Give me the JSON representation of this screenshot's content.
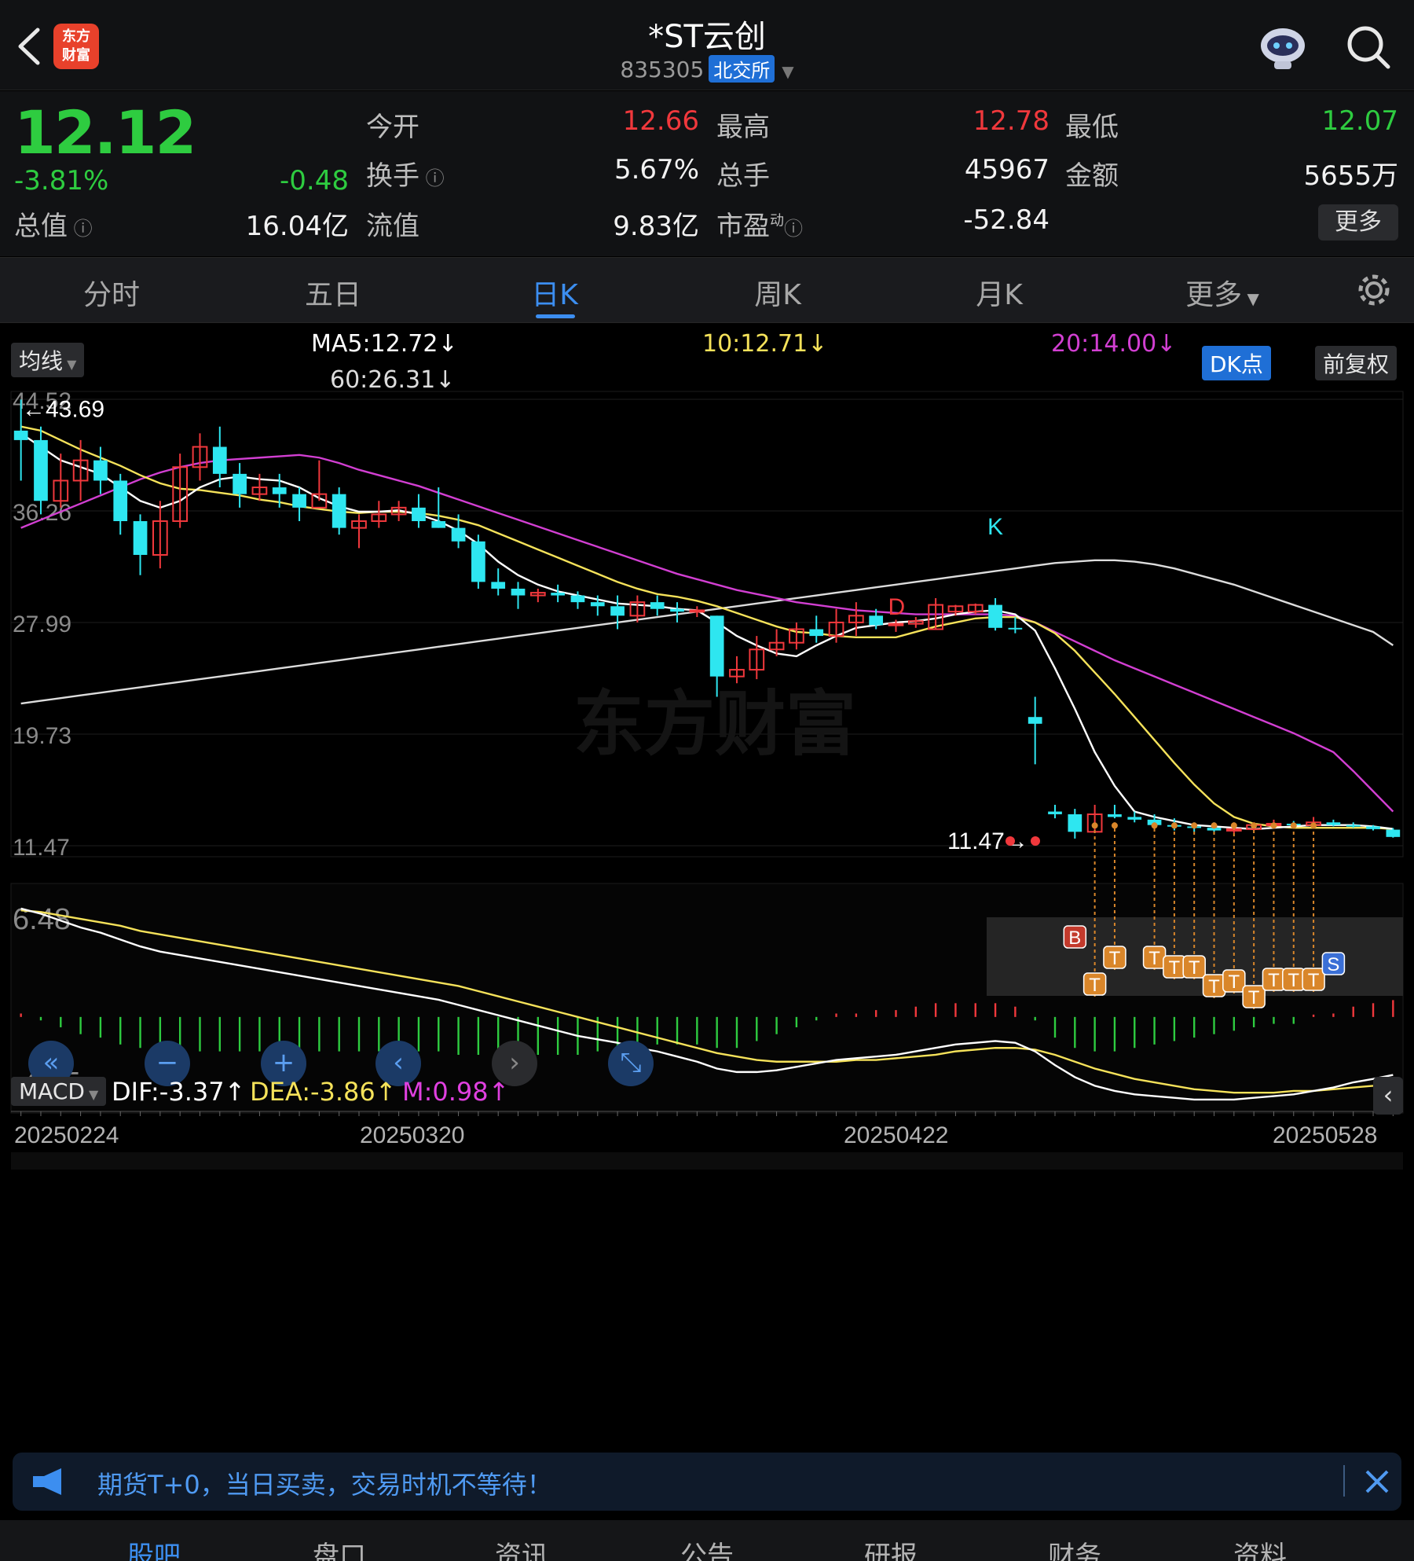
{
  "header": {
    "title": "*ST云创",
    "code": "835305",
    "exchange": "北交所",
    "logo_text_1": "东方",
    "logo_text_2": "财富"
  },
  "quote": {
    "price": "12.12",
    "change_pct": "-3.81%",
    "change": "-0.48",
    "open_label": "今开",
    "open": "12.66",
    "high_label": "最高",
    "high": "12.78",
    "low_label": "最低",
    "low": "12.07",
    "turnover_label": "换手",
    "turnover": "5.67%",
    "volume_label": "总手",
    "volume": "45967",
    "amount_label": "金额",
    "amount": "5655万",
    "mktcap_label": "总值",
    "mktcap": "16.04亿",
    "float_label": "流值",
    "float": "9.83亿",
    "pe_label": "市盈",
    "pe_sup": "动",
    "pe": "-52.84",
    "more_label": "更多"
  },
  "tabs": [
    "分时",
    "五日",
    "日K",
    "周K",
    "月K",
    "更多"
  ],
  "active_tab": 2,
  "indicators": {
    "ma_selector": "均线",
    "ma5": "MA5:12.72↓",
    "ma10": "10:12.71↓",
    "ma20": "20:14.00↓",
    "ma60": "60:26.31↓",
    "dk_button": "DK点",
    "adjust_button": "前复权",
    "macd_selector": "MACD",
    "dif": "DIF:-3.37↑",
    "dea": "DEA:-3.86↑",
    "m": "M:0.98↑"
  },
  "colors": {
    "up": "#f0383c",
    "down": "#2ee6f0",
    "ma5": "#ffffff",
    "ma10": "#f5e25a",
    "ma20": "#d23fd2",
    "ma60": "#dcdcdc",
    "accent": "#3c8ef0"
  },
  "price_axis": {
    "labels": [
      "44.52",
      "36.26",
      "27.99",
      "19.73",
      "11.47"
    ],
    "max_mark": "←43.69",
    "min_mark": "11.47→"
  },
  "macd_axis": {
    "top": "6.48",
    "bottom": "-4.85"
  },
  "dates": [
    "20250224",
    "20250320",
    "20250422",
    "20250528"
  ],
  "signal_marks": {
    "B": "B",
    "T": "T",
    "S": "S",
    "K": "K",
    "D": "D"
  },
  "banner": {
    "text": "期货T+0，当日买卖，交易时机不等待！"
  },
  "bottom_nav": [
    "股吧",
    "盘口",
    "资讯",
    "公告",
    "研报",
    "财务",
    "资料"
  ],
  "chart_data": {
    "type": "candlestick",
    "ylim": [
      11.47,
      44.52
    ],
    "candles": [
      [
        42.2,
        44.5,
        38.5,
        41.5
      ],
      [
        41.5,
        42.5,
        36.0,
        37.0
      ],
      [
        37.0,
        40.5,
        36.5,
        38.5
      ],
      [
        38.5,
        41.5,
        37.0,
        40.0
      ],
      [
        40.0,
        41.0,
        37.5,
        38.5
      ],
      [
        38.5,
        39.0,
        34.5,
        35.5
      ],
      [
        35.5,
        36.0,
        31.5,
        33.0
      ],
      [
        33.0,
        37.0,
        32.0,
        35.5
      ],
      [
        35.5,
        40.5,
        35.0,
        39.5
      ],
      [
        39.5,
        42.0,
        38.5,
        41.0
      ],
      [
        41.0,
        42.5,
        38.0,
        39.0
      ],
      [
        39.0,
        39.8,
        36.5,
        37.5
      ],
      [
        37.5,
        39.0,
        37.0,
        38.0
      ],
      [
        38.0,
        39.0,
        36.5,
        37.5
      ],
      [
        37.5,
        38.0,
        35.5,
        36.5
      ],
      [
        36.5,
        40.0,
        37.0,
        37.5
      ],
      [
        37.5,
        38.0,
        34.5,
        35.0
      ],
      [
        35.0,
        36.0,
        33.5,
        35.5
      ],
      [
        35.5,
        37.0,
        35.0,
        36.0
      ],
      [
        36.0,
        37.0,
        35.5,
        36.5
      ],
      [
        36.5,
        37.5,
        35.0,
        35.5
      ],
      [
        35.5,
        38.0,
        35.0,
        35.0
      ],
      [
        35.0,
        36.0,
        33.5,
        34.0
      ],
      [
        34.0,
        34.5,
        30.5,
        31.0
      ],
      [
        31.0,
        32.0,
        30.0,
        30.5
      ],
      [
        30.5,
        31.0,
        29.0,
        30.0
      ],
      [
        30.0,
        30.5,
        29.5,
        30.2
      ],
      [
        30.2,
        30.8,
        29.5,
        30.0
      ],
      [
        30.0,
        30.3,
        29.0,
        29.5
      ],
      [
        29.5,
        30.0,
        28.5,
        29.2
      ],
      [
        29.2,
        30.0,
        27.5,
        28.5
      ],
      [
        28.5,
        30.0,
        28.0,
        29.5
      ],
      [
        29.5,
        30.0,
        28.5,
        29.0
      ],
      [
        29.0,
        29.5,
        28.0,
        28.8
      ],
      [
        28.8,
        29.2,
        28.4,
        28.9
      ],
      [
        28.5,
        28.5,
        22.5,
        24.0
      ],
      [
        24.0,
        25.5,
        23.5,
        24.5
      ],
      [
        24.5,
        27.0,
        23.8,
        26.0
      ],
      [
        26.0,
        27.5,
        25.5,
        26.5
      ],
      [
        26.5,
        28.0,
        26.0,
        27.5
      ],
      [
        27.5,
        28.5,
        26.5,
        27.0
      ],
      [
        27.0,
        29.0,
        26.5,
        28.0
      ],
      [
        28.0,
        29.5,
        27.0,
        28.5
      ],
      [
        28.5,
        29.0,
        27.5,
        27.8
      ],
      [
        27.8,
        28.2,
        27.3,
        27.9
      ],
      [
        27.9,
        28.4,
        27.6,
        28.1
      ],
      [
        27.5,
        29.8,
        27.5,
        29.3
      ],
      [
        28.8,
        29.3,
        28.5,
        29.2
      ],
      [
        28.8,
        29.4,
        28.6,
        29.3
      ],
      [
        29.3,
        29.8,
        27.4,
        27.6
      ],
      [
        27.6,
        28.4,
        27.2,
        27.5
      ],
      [
        21.0,
        22.5,
        17.5,
        20.5
      ],
      [
        14.0,
        14.5,
        13.5,
        13.8
      ],
      [
        13.8,
        14.2,
        12.0,
        12.5
      ],
      [
        12.5,
        14.5,
        12.5,
        13.8
      ],
      [
        13.8,
        14.5,
        13.5,
        13.6
      ],
      [
        13.6,
        14.0,
        13.2,
        13.4
      ],
      [
        13.4,
        13.8,
        12.8,
        13.0
      ],
      [
        13.0,
        13.5,
        12.6,
        12.9
      ],
      [
        12.9,
        13.2,
        12.5,
        12.8
      ],
      [
        12.8,
        13.2,
        12.3,
        12.6
      ],
      [
        12.6,
        13.0,
        12.4,
        12.7
      ],
      [
        12.7,
        13.2,
        12.6,
        13.0
      ],
      [
        13.0,
        13.4,
        12.8,
        13.1
      ],
      [
        13.1,
        13.3,
        12.9,
        13.0
      ],
      [
        13.0,
        13.6,
        12.9,
        13.2
      ],
      [
        13.2,
        13.4,
        12.9,
        13.0
      ],
      [
        13.0,
        13.2,
        12.8,
        12.9
      ],
      [
        12.9,
        13.0,
        12.6,
        12.7
      ],
      [
        12.66,
        12.78,
        12.07,
        12.12
      ]
    ],
    "ma5": [
      42.0,
      41.0,
      40.0,
      39.5,
      39.0,
      38.0,
      37.0,
      36.5,
      37.0,
      38.0,
      38.6,
      38.8,
      38.6,
      38.5,
      38.0,
      37.2,
      36.6,
      36.2,
      36.2,
      36.3,
      36.0,
      35.5,
      34.8,
      33.8,
      32.5,
      31.5,
      30.8,
      30.3,
      30.0,
      29.7,
      29.4,
      29.3,
      29.2,
      29.0,
      28.9,
      28.0,
      27.0,
      26.3,
      25.7,
      25.5,
      26.3,
      27.0,
      27.6,
      27.8,
      28.0,
      28.1,
      28.3,
      28.6,
      28.8,
      28.9,
      28.6,
      27.4,
      24.6,
      21.6,
      18.4,
      15.9,
      14.0,
      13.6,
      13.3,
      13.0,
      12.9,
      12.8,
      12.7,
      12.8,
      12.9,
      13.0,
      13.0,
      13.0,
      12.9,
      12.72
    ],
    "ma10": [
      42.5,
      42.2,
      41.5,
      40.8,
      40.2,
      39.6,
      38.9,
      38.3,
      37.9,
      37.8,
      37.6,
      37.4,
      37.1,
      36.9,
      36.6,
      36.4,
      36.2,
      36.1,
      36.2,
      36.2,
      36.1,
      35.9,
      35.6,
      35.2,
      34.6,
      34.0,
      33.4,
      32.8,
      32.2,
      31.6,
      31.0,
      30.5,
      30.1,
      29.9,
      29.6,
      29.2,
      28.7,
      28.2,
      27.7,
      27.3,
      27.2,
      27.0,
      26.9,
      26.9,
      26.9,
      27.3,
      27.7,
      28.0,
      28.3,
      28.4,
      28.4,
      28.0,
      27.2,
      25.9,
      24.3,
      22.7,
      21.0,
      19.3,
      17.6,
      16.0,
      14.6,
      13.6,
      13.1,
      12.9,
      12.8,
      12.8,
      12.8,
      12.8,
      12.8,
      12.71
    ],
    "ma20": [
      35.0,
      35.6,
      36.2,
      36.8,
      37.4,
      38.0,
      38.6,
      39.1,
      39.5,
      39.8,
      40.0,
      40.1,
      40.2,
      40.3,
      40.4,
      40.2,
      39.8,
      39.3,
      38.9,
      38.5,
      38.1,
      37.6,
      37.1,
      36.6,
      36.1,
      35.6,
      35.1,
      34.6,
      34.1,
      33.6,
      33.1,
      32.6,
      32.1,
      31.6,
      31.2,
      30.8,
      30.4,
      30.1,
      29.8,
      29.5,
      29.3,
      29.1,
      28.9,
      28.8,
      28.7,
      28.6,
      28.6,
      28.6,
      28.6,
      28.6,
      28.5,
      28.0,
      27.3,
      26.6,
      25.9,
      25.2,
      24.6,
      24.0,
      23.4,
      22.8,
      22.2,
      21.6,
      21.0,
      20.4,
      19.8,
      19.1,
      18.4,
      17.0,
      15.5,
      14.0
    ],
    "ma60": [
      22.0,
      22.2,
      22.4,
      22.6,
      22.8,
      23.0,
      23.2,
      23.4,
      23.6,
      23.8,
      24.0,
      24.2,
      24.4,
      24.6,
      24.8,
      25.0,
      25.2,
      25.4,
      25.6,
      25.8,
      26.0,
      26.2,
      26.4,
      26.6,
      26.8,
      27.0,
      27.2,
      27.4,
      27.6,
      27.8,
      28.0,
      28.2,
      28.4,
      28.6,
      28.8,
      29.0,
      29.2,
      29.4,
      29.6,
      29.8,
      30.0,
      30.2,
      30.4,
      30.6,
      30.8,
      31.0,
      31.2,
      31.4,
      31.6,
      31.8,
      32.0,
      32.2,
      32.4,
      32.5,
      32.6,
      32.6,
      32.5,
      32.3,
      32.0,
      31.6,
      31.2,
      30.8,
      30.3,
      29.8,
      29.3,
      28.8,
      28.3,
      27.8,
      27.3,
      26.31
    ],
    "macd_dif": [
      6.3,
      6.0,
      5.6,
      5.2,
      4.9,
      4.5,
      4.1,
      3.8,
      3.6,
      3.4,
      3.2,
      3.0,
      2.8,
      2.6,
      2.4,
      2.2,
      2.0,
      1.8,
      1.6,
      1.4,
      1.2,
      1.0,
      0.7,
      0.4,
      0.1,
      -0.2,
      -0.5,
      -0.8,
      -1.1,
      -1.3,
      -1.5,
      -1.8,
      -2.0,
      -2.3,
      -2.6,
      -3.0,
      -3.2,
      -3.2,
      -3.1,
      -2.9,
      -2.7,
      -2.5,
      -2.4,
      -2.3,
      -2.2,
      -2.0,
      -1.8,
      -1.6,
      -1.5,
      -1.4,
      -1.5,
      -2.0,
      -2.8,
      -3.5,
      -4.0,
      -4.3,
      -4.5,
      -4.6,
      -4.7,
      -4.8,
      -4.8,
      -4.8,
      -4.7,
      -4.6,
      -4.5,
      -4.3,
      -4.1,
      -3.8,
      -3.6,
      -3.37
    ],
    "macd_dea": [
      6.2,
      6.1,
      5.9,
      5.7,
      5.5,
      5.3,
      5.0,
      4.8,
      4.6,
      4.4,
      4.2,
      4.0,
      3.8,
      3.6,
      3.4,
      3.2,
      3.0,
      2.8,
      2.6,
      2.4,
      2.2,
      2.0,
      1.8,
      1.5,
      1.2,
      0.9,
      0.6,
      0.3,
      0.0,
      -0.3,
      -0.6,
      -0.9,
      -1.2,
      -1.5,
      -1.8,
      -2.1,
      -2.3,
      -2.5,
      -2.6,
      -2.6,
      -2.6,
      -2.6,
      -2.5,
      -2.5,
      -2.4,
      -2.3,
      -2.2,
      -2.0,
      -1.9,
      -1.8,
      -1.8,
      -1.9,
      -2.2,
      -2.6,
      -3.0,
      -3.3,
      -3.6,
      -3.8,
      -4.0,
      -4.2,
      -4.3,
      -4.4,
      -4.4,
      -4.4,
      -4.3,
      -4.3,
      -4.2,
      -4.1,
      -4.0,
      -3.86
    ],
    "macd_ylim": [
      -4.85,
      6.48
    ]
  }
}
